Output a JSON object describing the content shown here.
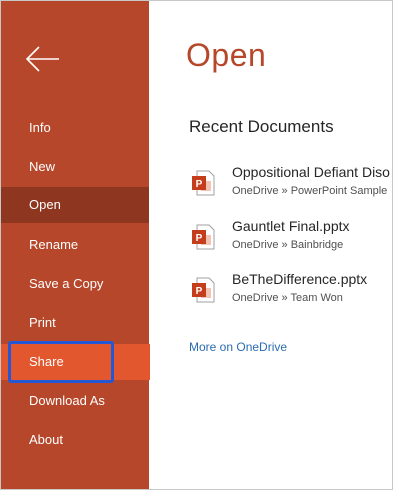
{
  "sidebar": {
    "back_icon": "arrow-left-icon",
    "items": [
      {
        "label": "Info"
      },
      {
        "label": "New"
      },
      {
        "label": "Open"
      },
      {
        "label": "Rename"
      },
      {
        "label": "Save a Copy"
      },
      {
        "label": "Print"
      },
      {
        "label": "Share"
      },
      {
        "label": "Download As"
      },
      {
        "label": "About"
      }
    ],
    "active_item": "Open",
    "highlighted_item": "Share"
  },
  "main": {
    "title": "Open",
    "section_title": "Recent Documents",
    "documents": [
      {
        "name": "Oppositional Defiant Diso",
        "path": "OneDrive » PowerPoint Sample",
        "icon": "powerpoint-file-icon"
      },
      {
        "name": "Gauntlet Final.pptx",
        "path": "OneDrive » Bainbridge",
        "icon": "powerpoint-file-icon"
      },
      {
        "name": "BeTheDifference.pptx",
        "path": "OneDrive » Team Won",
        "icon": "powerpoint-file-icon"
      }
    ],
    "more_link": "More on OneDrive"
  },
  "colors": {
    "sidebar_bg": "#b7472a",
    "sidebar_active": "#8f3620",
    "sidebar_hover": "#e3572f",
    "title": "#b7472a",
    "link": "#2b6cb0",
    "annotation_box": "#2457d6"
  }
}
